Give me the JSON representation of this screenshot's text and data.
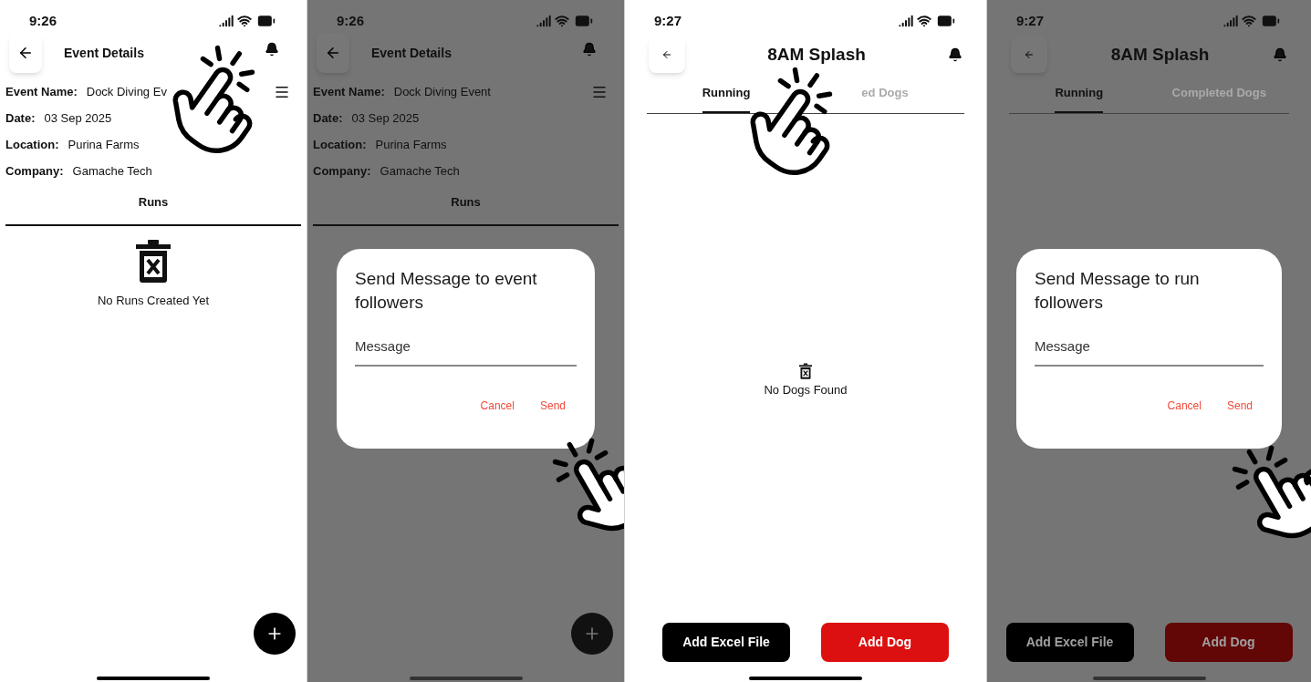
{
  "screens": [
    {
      "kind": "event_details",
      "time": "9:26",
      "title": "Event Details",
      "fields": [
        {
          "label": "Event Name:",
          "value": "Dock Diving Ev"
        },
        {
          "label": "Date:",
          "value": "03 Sep 2025"
        },
        {
          "label": "Location:",
          "value": "Purina Farms"
        },
        {
          "label": "Company:",
          "value": "Gamache Tech"
        }
      ],
      "section_tab": "Runs",
      "empty_text": "No Runs Created Yet"
    },
    {
      "kind": "event_details",
      "time": "9:26",
      "title": "Event Details",
      "fields": [
        {
          "label": "Event Name:",
          "value": "Dock Diving Event"
        },
        {
          "label": "Date:",
          "value": "03 Sep 2025"
        },
        {
          "label": "Location:",
          "value": "Purina Farms"
        },
        {
          "label": "Company:",
          "value": "Gamache Tech"
        }
      ],
      "section_tab": "Runs",
      "dialog": {
        "title": "Send Message to event followers",
        "placeholder": "Message",
        "actions": [
          "Cancel",
          "Send"
        ]
      }
    },
    {
      "kind": "run_details",
      "time": "9:27",
      "title": "8AM Splash",
      "tabs": [
        {
          "label": "Running",
          "selected": true
        },
        {
          "label": "ed Dogs",
          "selected": false
        }
      ],
      "empty_text": "No Dogs Found",
      "buttons": [
        {
          "label": "Add Excel File",
          "color": "#000000"
        },
        {
          "label": "Add Dog",
          "color": "#dc1010"
        }
      ]
    },
    {
      "kind": "run_details",
      "time": "9:27",
      "title": "8AM Splash",
      "tabs": [
        {
          "label": "Running",
          "selected": true
        },
        {
          "label": "Completed Dogs",
          "selected": false
        }
      ],
      "buttons": [
        {
          "label": "Add Excel File",
          "color": "#000000"
        },
        {
          "label": "Add Dog",
          "color": "#620606"
        }
      ],
      "dialog": {
        "title": "Send Message to run followers",
        "placeholder": "Message",
        "actions": [
          "Cancel",
          "Send"
        ]
      }
    }
  ]
}
